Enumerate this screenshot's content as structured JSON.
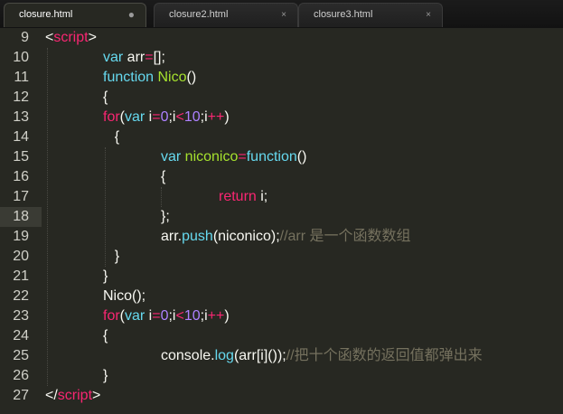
{
  "tabs": [
    {
      "label": "closure.html",
      "button": "●",
      "active": true
    },
    {
      "label": "closure2.html",
      "button": "×",
      "active": false
    },
    {
      "label": "closure3.html",
      "button": "×",
      "active": false
    }
  ],
  "editor": {
    "current_line": 18,
    "lines": [
      {
        "n": "9",
        "indent": 0,
        "tokens": [
          [
            "pl",
            "<"
          ],
          [
            "tg",
            "script"
          ],
          [
            "pl",
            ">"
          ]
        ]
      },
      {
        "n": "10",
        "indent": 1,
        "tokens": [
          [
            "ty",
            "var "
          ],
          [
            "pl",
            "arr"
          ],
          [
            "op",
            "="
          ],
          [
            "pl",
            "[];"
          ]
        ]
      },
      {
        "n": "11",
        "indent": 1,
        "tokens": [
          [
            "ty",
            "function "
          ],
          [
            "fn",
            "Nico"
          ],
          [
            "pl",
            "()"
          ]
        ]
      },
      {
        "n": "12",
        "indent": 1,
        "tokens": [
          [
            "pl",
            "{"
          ]
        ]
      },
      {
        "n": "13",
        "indent": 1,
        "tokens": [
          [
            "kw",
            "for"
          ],
          [
            "pl",
            "("
          ],
          [
            "ty",
            "var "
          ],
          [
            "pl",
            "i"
          ],
          [
            "op",
            "="
          ],
          [
            "nm",
            "0"
          ],
          [
            "pl",
            ";i"
          ],
          [
            "op",
            "<"
          ],
          [
            "nm",
            "10"
          ],
          [
            "pl",
            ";i"
          ],
          [
            "op",
            "++"
          ],
          [
            "pl",
            ")"
          ]
        ]
      },
      {
        "n": "14",
        "indent": 1.2,
        "tokens": [
          [
            "pl",
            "{"
          ]
        ]
      },
      {
        "n": "15",
        "indent": 2,
        "tokens": [
          [
            "ty",
            "var "
          ],
          [
            "fn",
            "niconico"
          ],
          [
            "op",
            "="
          ],
          [
            "ty",
            "function"
          ],
          [
            "pl",
            "()"
          ]
        ]
      },
      {
        "n": "16",
        "indent": 2,
        "tokens": [
          [
            "pl",
            "{"
          ]
        ]
      },
      {
        "n": "17",
        "indent": 3,
        "tokens": [
          [
            "kw",
            "return "
          ],
          [
            "pl",
            "i;"
          ]
        ]
      },
      {
        "n": "18",
        "indent": 2,
        "tokens": [
          [
            "pl",
            "};"
          ]
        ]
      },
      {
        "n": "19",
        "indent": 2,
        "tokens": [
          [
            "pl",
            "arr."
          ],
          [
            "ty",
            "push"
          ],
          [
            "pl",
            "(niconico);"
          ],
          [
            "cm",
            "//arr 是一个函数数组"
          ]
        ]
      },
      {
        "n": "20",
        "indent": 1.2,
        "tokens": [
          [
            "pl",
            "}"
          ]
        ]
      },
      {
        "n": "21",
        "indent": 1,
        "tokens": [
          [
            "pl",
            "}"
          ]
        ]
      },
      {
        "n": "22",
        "indent": 1,
        "tokens": [
          [
            "pl",
            "Nico();"
          ]
        ]
      },
      {
        "n": "23",
        "indent": 1,
        "tokens": [
          [
            "kw",
            "for"
          ],
          [
            "pl",
            "("
          ],
          [
            "ty",
            "var "
          ],
          [
            "pl",
            "i"
          ],
          [
            "op",
            "="
          ],
          [
            "nm",
            "0"
          ],
          [
            "pl",
            ";i"
          ],
          [
            "op",
            "<"
          ],
          [
            "nm",
            "10"
          ],
          [
            "pl",
            ";i"
          ],
          [
            "op",
            "++"
          ],
          [
            "pl",
            ")"
          ]
        ]
      },
      {
        "n": "24",
        "indent": 1,
        "tokens": [
          [
            "pl",
            "{"
          ]
        ]
      },
      {
        "n": "25",
        "indent": 2,
        "tokens": [
          [
            "pl",
            "console."
          ],
          [
            "ty",
            "log"
          ],
          [
            "pl",
            "(arr[i]());"
          ],
          [
            "cm",
            "//把十个函数的返回值都弹出来"
          ]
        ]
      },
      {
        "n": "26",
        "indent": 1,
        "tokens": [
          [
            "pl",
            "}"
          ]
        ]
      },
      {
        "n": "27",
        "indent": 0,
        "tokens": [
          [
            "pl",
            "</"
          ],
          [
            "tg",
            "script"
          ],
          [
            "pl",
            ">"
          ]
        ]
      }
    ]
  },
  "colors": {
    "background": "#272822",
    "plain": "#f8f8f2",
    "keyword": "#f92672",
    "type": "#66d9ef",
    "function": "#a6e22e",
    "number": "#ae81ff",
    "comment": "#75715e"
  }
}
